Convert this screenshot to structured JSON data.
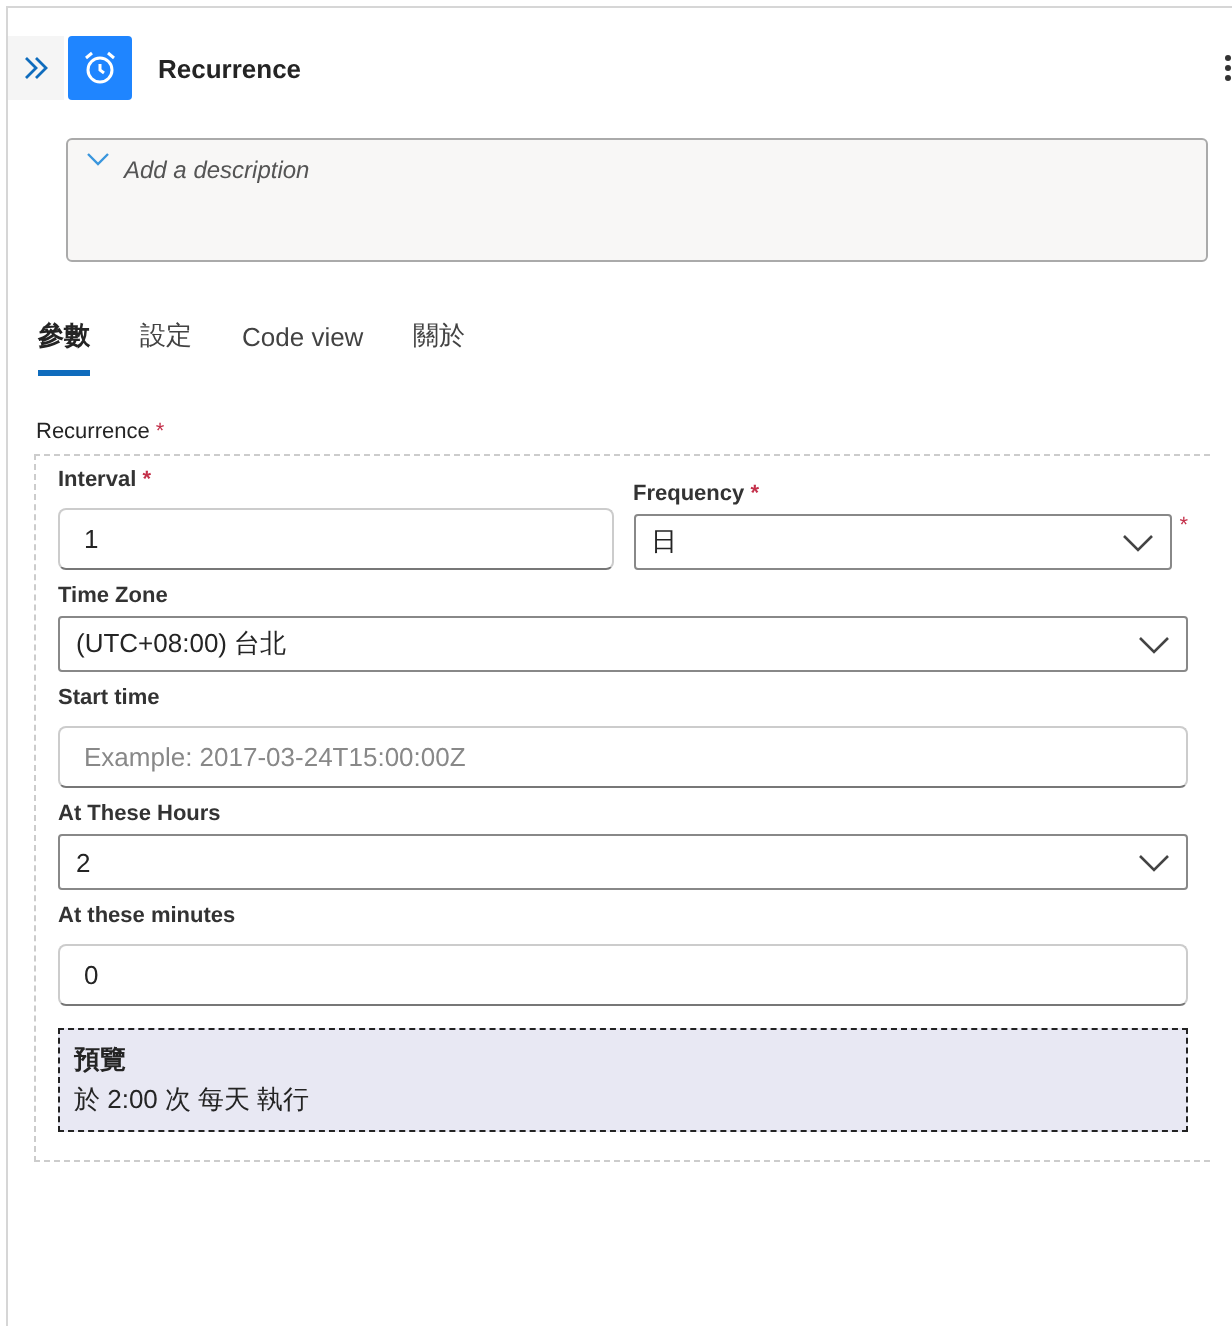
{
  "header": {
    "title": "Recurrence"
  },
  "description": {
    "placeholder": "Add a description"
  },
  "tabs": [
    {
      "label": "參數",
      "selected": true
    },
    {
      "label": "設定",
      "selected": false
    },
    {
      "label": "Code view",
      "selected": false
    },
    {
      "label": "關於",
      "selected": false
    }
  ],
  "section": {
    "label": "Recurrence",
    "required_mark": "*"
  },
  "rows": [
    {
      "fields": [
        {
          "kind": "text",
          "label": "Interval",
          "required_mark": "*",
          "value": "1"
        },
        {
          "kind": "dropdown",
          "label": "Frequency",
          "required_mark": "*",
          "value": "日",
          "trailing_mark": "*"
        }
      ]
    },
    {
      "fields": [
        {
          "kind": "dropdown",
          "label": "Time Zone",
          "value": "(UTC+08:00) 台北"
        }
      ]
    },
    {
      "fields": [
        {
          "kind": "text",
          "label": "Start time",
          "placeholder": "Example: 2017-03-24T15:00:00Z"
        }
      ]
    },
    {
      "fields": [
        {
          "kind": "dropdown",
          "label": "At These Hours",
          "value": "2"
        }
      ]
    },
    {
      "fields": [
        {
          "kind": "text",
          "label": "At these minutes",
          "value": "0"
        }
      ]
    }
  ],
  "preview": {
    "title": "預覽",
    "text": "於 2:00 次 每天 執行"
  }
}
